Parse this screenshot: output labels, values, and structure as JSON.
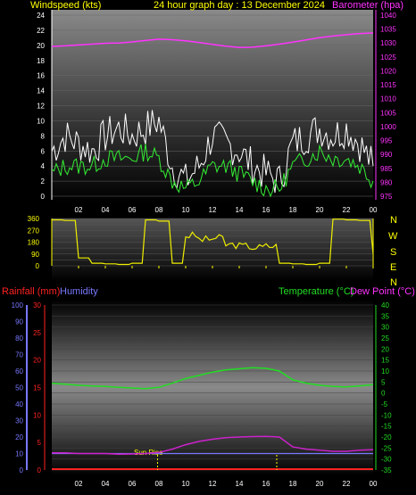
{
  "header": {
    "left_label": "Windspeed (kts)",
    "center_title": "24 hour graph day : 13 December 2024",
    "right_label": "Barometer (hpa)"
  },
  "lower_header": {
    "rainfall_label": "Rainfall (mm)",
    "humidity_label": "Humidity",
    "temperature_label": "Temperature (°C)",
    "dewpoint_label": "Dew Point (°C)"
  },
  "sunrise_label": "Sun Rise",
  "compass": [
    "N",
    "W",
    "S",
    "E",
    "N"
  ],
  "hour_ticks": [
    "02",
    "04",
    "06",
    "08",
    "10",
    "12",
    "14",
    "16",
    "18",
    "20",
    "22",
    "00"
  ],
  "colors": {
    "barometer": "#ff33ff",
    "wind": "#ffffff",
    "wind_avg": "#33ee33",
    "direction": "#eeee00",
    "temperature": "#22dd22",
    "dewpoint": "#cc22cc",
    "humidity": "#7777ff",
    "rainfall": "#ff2222",
    "header_yellow": "#ffff00",
    "header_magenta": "#ff33ff"
  },
  "chart_data": [
    {
      "type": "line",
      "title": "24 hour graph day : 13 December 2024",
      "ylabel": "Windspeed (kts)",
      "y2label": "Barometer (hpa)",
      "ylim": [
        0,
        24
      ],
      "y2lim": [
        975,
        1040
      ],
      "yticks": [
        0,
        2,
        4,
        6,
        8,
        10,
        12,
        14,
        16,
        18,
        20,
        22,
        24
      ],
      "y2ticks": [
        975,
        980,
        985,
        990,
        995,
        1000,
        1005,
        1010,
        1015,
        1020,
        1025,
        1030,
        1035,
        1040
      ],
      "x_hours": [
        0,
        1,
        2,
        3,
        4,
        5,
        6,
        7,
        8,
        9,
        10,
        11,
        12,
        13,
        14,
        15,
        16,
        17,
        18,
        19,
        20,
        21,
        22,
        23,
        24
      ],
      "series": [
        {
          "name": "Barometer (hpa)",
          "axis": "right",
          "values": [
            1028.8,
            1029.0,
            1029.3,
            1029.6,
            1029.9,
            1030.0,
            1030.4,
            1030.9,
            1031.4,
            1031.2,
            1030.8,
            1030.2,
            1029.5,
            1028.9,
            1028.4,
            1028.5,
            1029.0,
            1029.6,
            1030.3,
            1031.1,
            1031.9,
            1032.5,
            1033.0,
            1033.4,
            1033.6
          ]
        },
        {
          "name": "Wind gust (kts)",
          "axis": "left",
          "values": [
            6,
            8,
            7,
            6,
            8,
            9,
            8,
            9,
            10,
            4,
            2,
            4,
            8,
            7,
            6,
            4,
            3,
            2,
            7,
            8,
            9,
            8,
            9,
            7,
            4
          ]
        },
        {
          "name": "Wind average (kts)",
          "axis": "left",
          "values": [
            3,
            4,
            4,
            4,
            5,
            5,
            5,
            6,
            5,
            2,
            1,
            2,
            4,
            4,
            3,
            2,
            1,
            1,
            4,
            5,
            6,
            5,
            5,
            4,
            2
          ]
        }
      ]
    },
    {
      "type": "line",
      "ylabel": "Wind direction",
      "ylim": [
        0,
        360
      ],
      "yticks": [
        0,
        45,
        90,
        135,
        180,
        225,
        270,
        315,
        360
      ],
      "x_hours": [
        0,
        1,
        2,
        3,
        4,
        5,
        6,
        7,
        8,
        9,
        10,
        11,
        12,
        13,
        14,
        15,
        16,
        17,
        18,
        19,
        20,
        21,
        22,
        23,
        24
      ],
      "series": [
        {
          "name": "Wind direction",
          "values": [
            350,
            345,
            60,
            20,
            15,
            10,
            20,
            350,
            340,
            20,
            230,
            200,
            210,
            160,
            150,
            140,
            150,
            20,
            15,
            10,
            20,
            355,
            350,
            345,
            90
          ]
        }
      ]
    },
    {
      "type": "line",
      "ylabel": "Humidity",
      "y2label": "Temperature (°C)",
      "ylim": [
        0,
        100
      ],
      "yticks": [
        0,
        10,
        20,
        30,
        40,
        50,
        60,
        70,
        80,
        90,
        100
      ],
      "rain_ticks": [
        0,
        5,
        10,
        15,
        20,
        25,
        30
      ],
      "y2lim": [
        -35,
        40
      ],
      "y2ticks": [
        -35,
        -30,
        -25,
        -20,
        -15,
        -10,
        -5,
        0,
        5,
        10,
        15,
        20,
        25,
        30,
        35,
        40
      ],
      "sunrise_hour": 7.9,
      "sunset_hour": 16.8,
      "x_hours": [
        0,
        1,
        2,
        3,
        4,
        5,
        6,
        7,
        8,
        9,
        10,
        11,
        12,
        13,
        14,
        15,
        16,
        17,
        18,
        19,
        20,
        21,
        22,
        23,
        24
      ],
      "series": [
        {
          "name": "Temperature (°C)",
          "axis": "right",
          "values": [
            4.5,
            4.0,
            3.5,
            3.2,
            3.0,
            2.6,
            2.3,
            2.0,
            2.6,
            4.5,
            6.6,
            8.0,
            9.5,
            10.5,
            11.0,
            11.5,
            11.2,
            10.0,
            6.0,
            4.5,
            3.5,
            3.0,
            2.8,
            3.2,
            3.8
          ]
        },
        {
          "name": "Dew Point (°C)",
          "axis": "right",
          "values": [
            -27.2,
            -27.2,
            -27.5,
            -27.5,
            -27.5,
            -27.8,
            -27.7,
            -27.5,
            -27.0,
            -25.5,
            -23.5,
            -22.0,
            -21.0,
            -20.3,
            -20.0,
            -19.8,
            -19.7,
            -20.0,
            -24.5,
            -25.5,
            -26.0,
            -26.5,
            -26.5,
            -26.0,
            -25.8
          ]
        },
        {
          "name": "Humidity",
          "axis": "left",
          "values": [
            10,
            10,
            10,
            10,
            10,
            10,
            10,
            10,
            10,
            10,
            10,
            10,
            10,
            10,
            10,
            10,
            10,
            10,
            10,
            10,
            10,
            10,
            10,
            10,
            10
          ]
        },
        {
          "name": "Rainfall (mm)",
          "axis": "left",
          "values": [
            0,
            0,
            0,
            0,
            0,
            0,
            0,
            0,
            0,
            0,
            0,
            0,
            0,
            0,
            0,
            0,
            0,
            0,
            0,
            0,
            0,
            0,
            0,
            0,
            0
          ]
        }
      ]
    }
  ]
}
